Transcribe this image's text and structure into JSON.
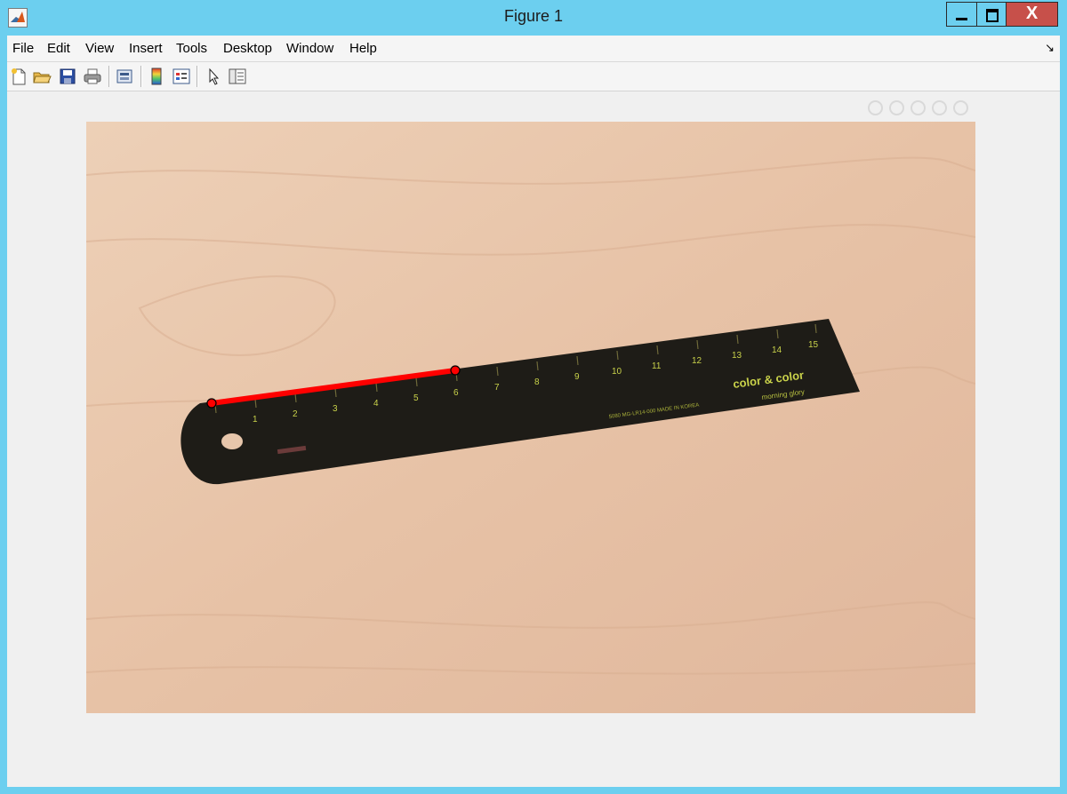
{
  "window": {
    "title": "Figure 1",
    "close_glyph": "X"
  },
  "menu": [
    {
      "label": "File"
    },
    {
      "label": "Edit"
    },
    {
      "label": "View"
    },
    {
      "label": "Insert"
    },
    {
      "label": "Tools"
    },
    {
      "label": "Desktop"
    },
    {
      "label": "Window"
    },
    {
      "label": "Help"
    }
  ],
  "menu_dock_glyph": "↘",
  "toolbar": {
    "icons": [
      "new-figure-icon",
      "open-file-icon",
      "save-icon",
      "print-icon",
      "print-preview-icon",
      "colorbar-icon",
      "legend-icon",
      "edit-plot-pointer-icon",
      "property-inspector-icon"
    ]
  },
  "axes_toolbar": {
    "icons": [
      "export-icon",
      "pan-icon",
      "zoom-in-icon",
      "zoom-out-icon",
      "home-icon"
    ]
  },
  "image": {
    "subject": "black ruler on wooden table",
    "ruler_numbers": [
      "1",
      "2",
      "3",
      "4",
      "5",
      "6",
      "7",
      "8",
      "9",
      "10",
      "11",
      "12",
      "13",
      "14",
      "15"
    ],
    "brand_text": "color & color",
    "brand_subtext": "morning glory",
    "fine_print": "5080 MG-LR14-000 MADE IN KOREA",
    "measurement_line_color": "#ff0000",
    "marker_color": "#ff0000",
    "wood_color": "#e6c2a6",
    "ruler_color": "#1e1c17",
    "text_color": "#c9d24a"
  }
}
